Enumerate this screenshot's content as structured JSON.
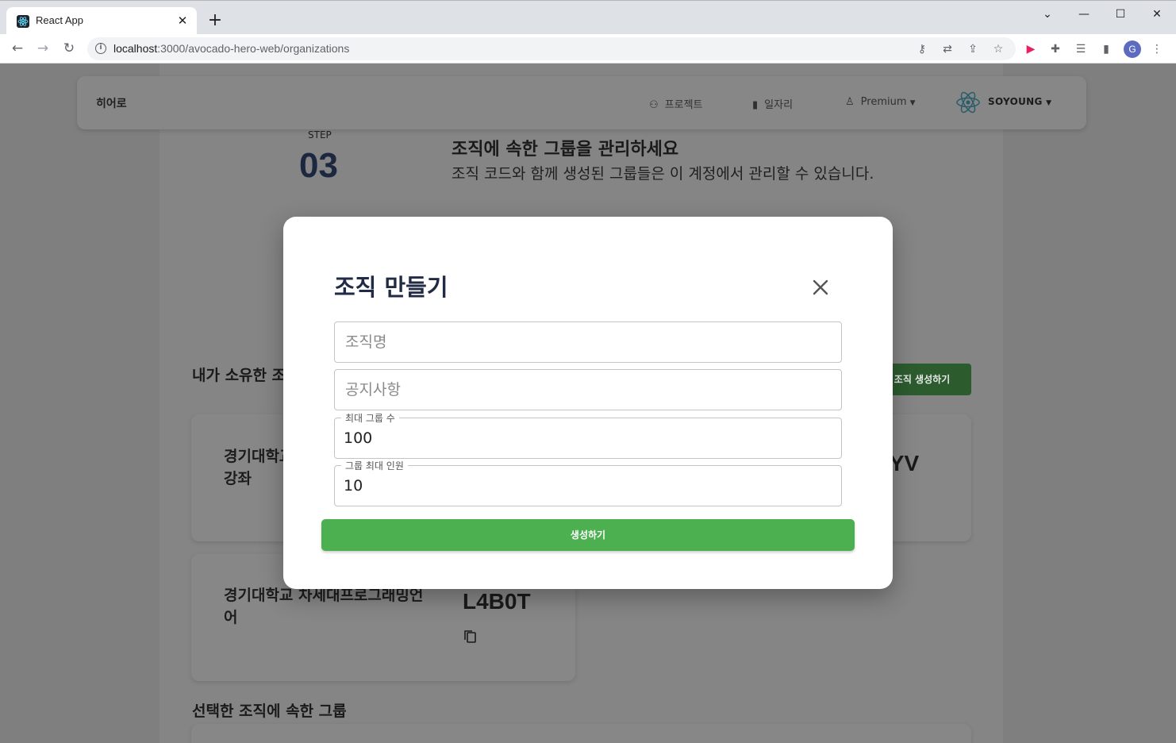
{
  "browser": {
    "tab_title": "React App",
    "url_host": "localhost",
    "url_path": ":3000/avocado-hero-web/organizations",
    "profile_initial": "G"
  },
  "app": {
    "brand": "히어로",
    "nav": {
      "projects": "프로젝트",
      "jobs": "일자리",
      "premium": "Premium"
    },
    "user": "SOYOUNG"
  },
  "step": {
    "label": "STEP",
    "number": "03",
    "title": "조직에 속한 그룹을 관리하세요",
    "desc": "조직 코드와 함께 생성된 그룹들은 이 계정에서 관리할 수 있습니다."
  },
  "owned_section": {
    "title": "내가 소유한 조직",
    "create_button": "조직 생성하기"
  },
  "cards": [
    {
      "name_line1": "경기대학교",
      "name_line2": "강좌",
      "code": "IYV"
    },
    {
      "name_line1": "경기대학교 차세대프로그래밍언",
      "name_line2": "어",
      "code": "L4B0T"
    }
  ],
  "groups_section": {
    "title": "선택한 조직에 속한 그룹"
  },
  "modal": {
    "title": "조직 만들기",
    "org_name_placeholder": "조직명",
    "notice_placeholder": "공지사항",
    "max_groups_label": "최대 그룹 수",
    "max_groups_value": "100",
    "max_members_label": "그룹 최대 인원",
    "max_members_value": "10",
    "submit": "생성하기"
  },
  "colors": {
    "accent_green": "#4caf50",
    "title_navy": "#222b45"
  }
}
